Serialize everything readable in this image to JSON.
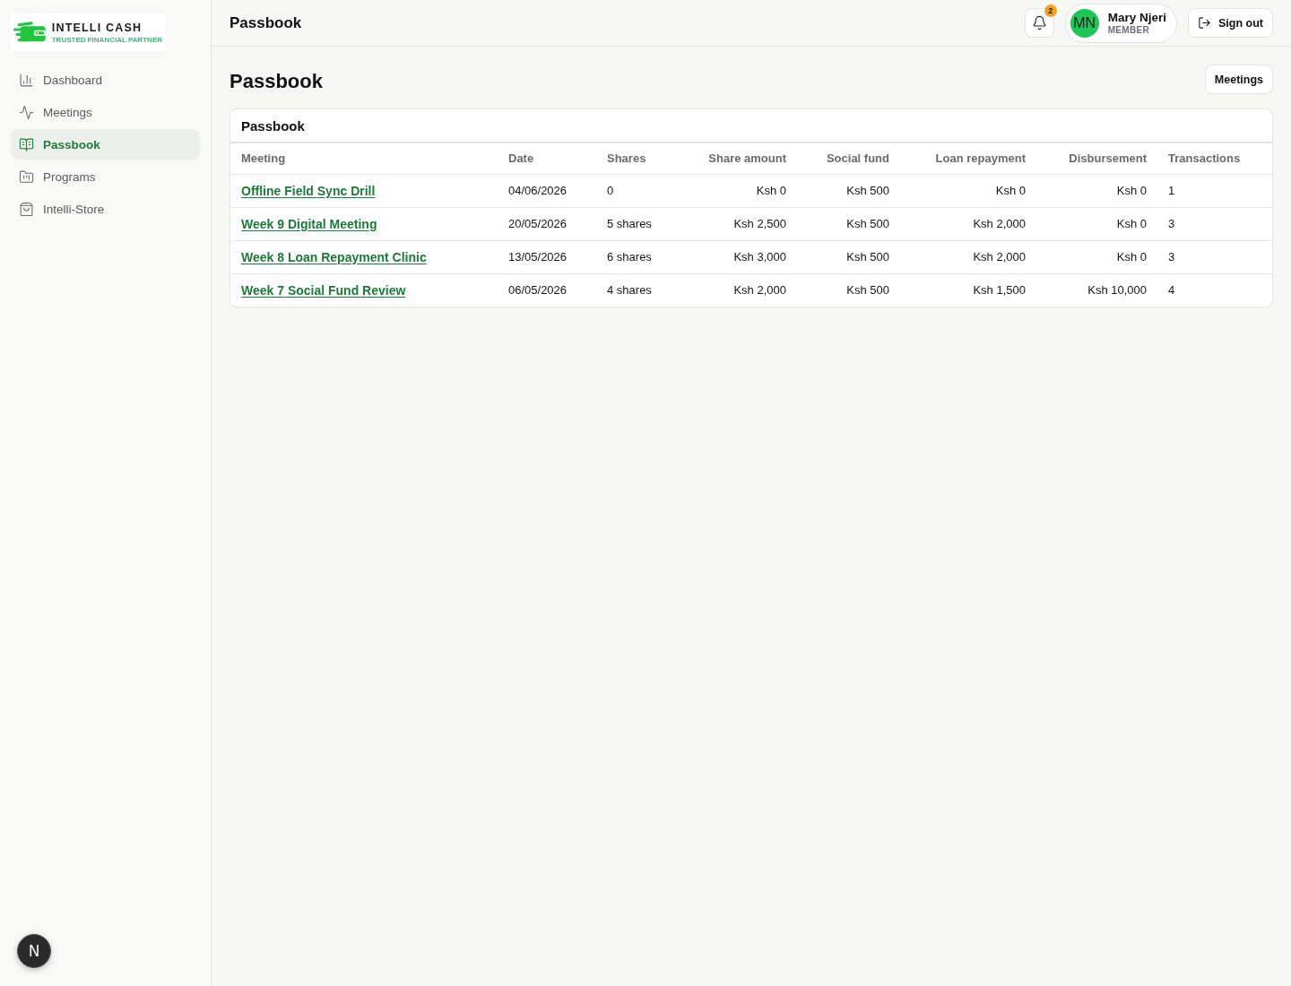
{
  "sidebar": {
    "logo": {
      "name": "INTELLI CASH",
      "tagline": "TRUSTED FINANCIAL PARTNER"
    },
    "items": [
      {
        "label": "Dashboard",
        "selected": false
      },
      {
        "label": "Meetings",
        "selected": false
      },
      {
        "label": "Passbook",
        "selected": true
      },
      {
        "label": "Programs",
        "selected": false
      },
      {
        "label": "Intelli-Store",
        "selected": false
      }
    ],
    "dev_button": {
      "label": "N"
    }
  },
  "header": {
    "title": "Passbook",
    "notifications": {
      "count": "2"
    },
    "user": {
      "initials": "MN",
      "name": "Mary Njeri",
      "role": "MEMBER"
    },
    "sign_out": "Sign out"
  },
  "page": {
    "title": "Passbook",
    "action": "Meetings"
  },
  "card": {
    "title": "Passbook",
    "columns": [
      {
        "label": "Meeting",
        "kind": "link"
      },
      {
        "label": "Date",
        "kind": "text"
      },
      {
        "label": "Shares",
        "kind": "text"
      },
      {
        "label": "Share amount",
        "kind": "money"
      },
      {
        "label": "Social fund",
        "kind": "money"
      },
      {
        "label": "Loan repayment",
        "kind": "money"
      },
      {
        "label": "Disbursement",
        "kind": "money"
      },
      {
        "label": "Transactions",
        "kind": "text"
      }
    ],
    "rows": [
      {
        "cells": [
          "Offline Field Sync Drill",
          "04/06/2026",
          "0",
          "Ksh 0",
          "Ksh 500",
          "Ksh 0",
          "Ksh 0",
          "1"
        ]
      },
      {
        "cells": [
          "Week 9 Digital Meeting",
          "20/05/2026",
          "5 shares",
          "Ksh 2,500",
          "Ksh 500",
          "Ksh 2,000",
          "Ksh 0",
          "3"
        ]
      },
      {
        "cells": [
          "Week 8 Loan Repayment Clinic",
          "13/05/2026",
          "6 shares",
          "Ksh 3,000",
          "Ksh 500",
          "Ksh 2,000",
          "Ksh 0",
          "3"
        ]
      },
      {
        "cells": [
          "Week 7 Social Fund Review",
          "06/05/2026",
          "4 shares",
          "Ksh 2,000",
          "Ksh 500",
          "Ksh 1,500",
          "Ksh 10,000",
          "4"
        ]
      }
    ]
  }
}
